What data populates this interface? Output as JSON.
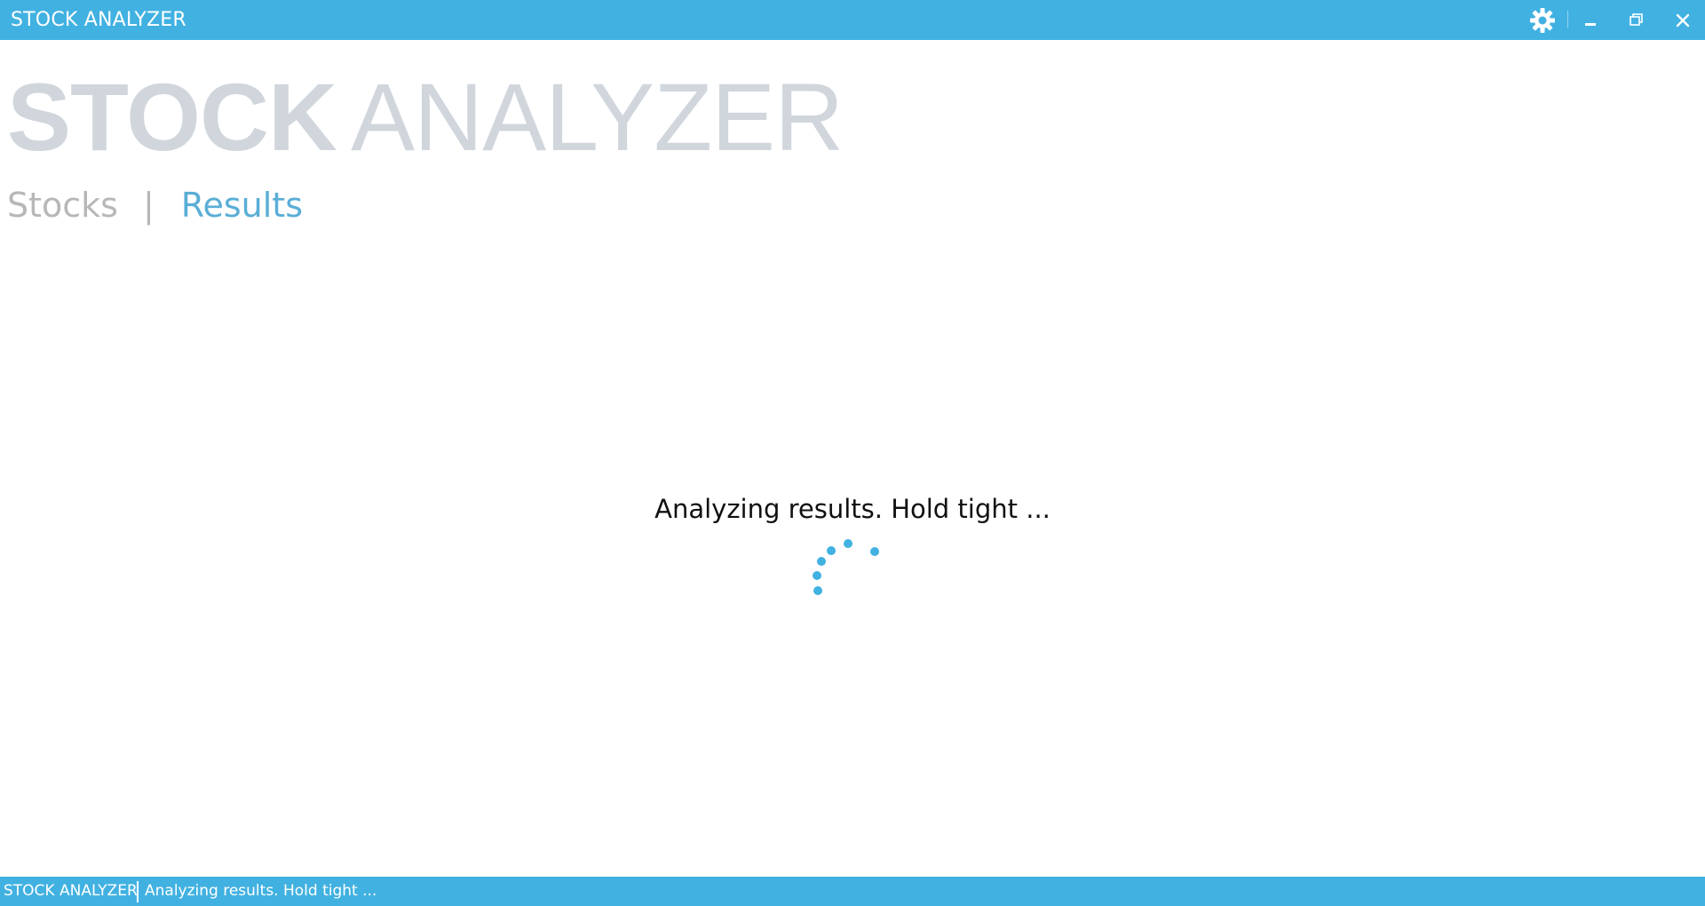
{
  "window": {
    "title": "STOCK ANALYZER",
    "controls": {
      "settings_icon": "gear-icon",
      "minimize_icon": "minimize-icon",
      "restore_icon": "restore-icon",
      "close_icon": "close-icon"
    }
  },
  "header": {
    "brand_bold": "STOCK",
    "brand_light": "ANALYZER",
    "nav": {
      "items": [
        {
          "label": "Stocks",
          "active": false
        },
        {
          "label": "Results",
          "active": true
        }
      ],
      "divider": "|"
    }
  },
  "main": {
    "loading_message": "Analyzing results. Hold tight ...",
    "spinner_icon": "loading-spinner-icon"
  },
  "statusbar": {
    "app_name": "STOCK ANALYZER",
    "message": "Analyzing results. Hold tight ..."
  },
  "colors": {
    "accent": "#41b1e1",
    "brand_text": "#d0d6dc",
    "nav_inactive": "#b7b7b7",
    "nav_active": "#5aaed6",
    "body_text": "#111111"
  }
}
